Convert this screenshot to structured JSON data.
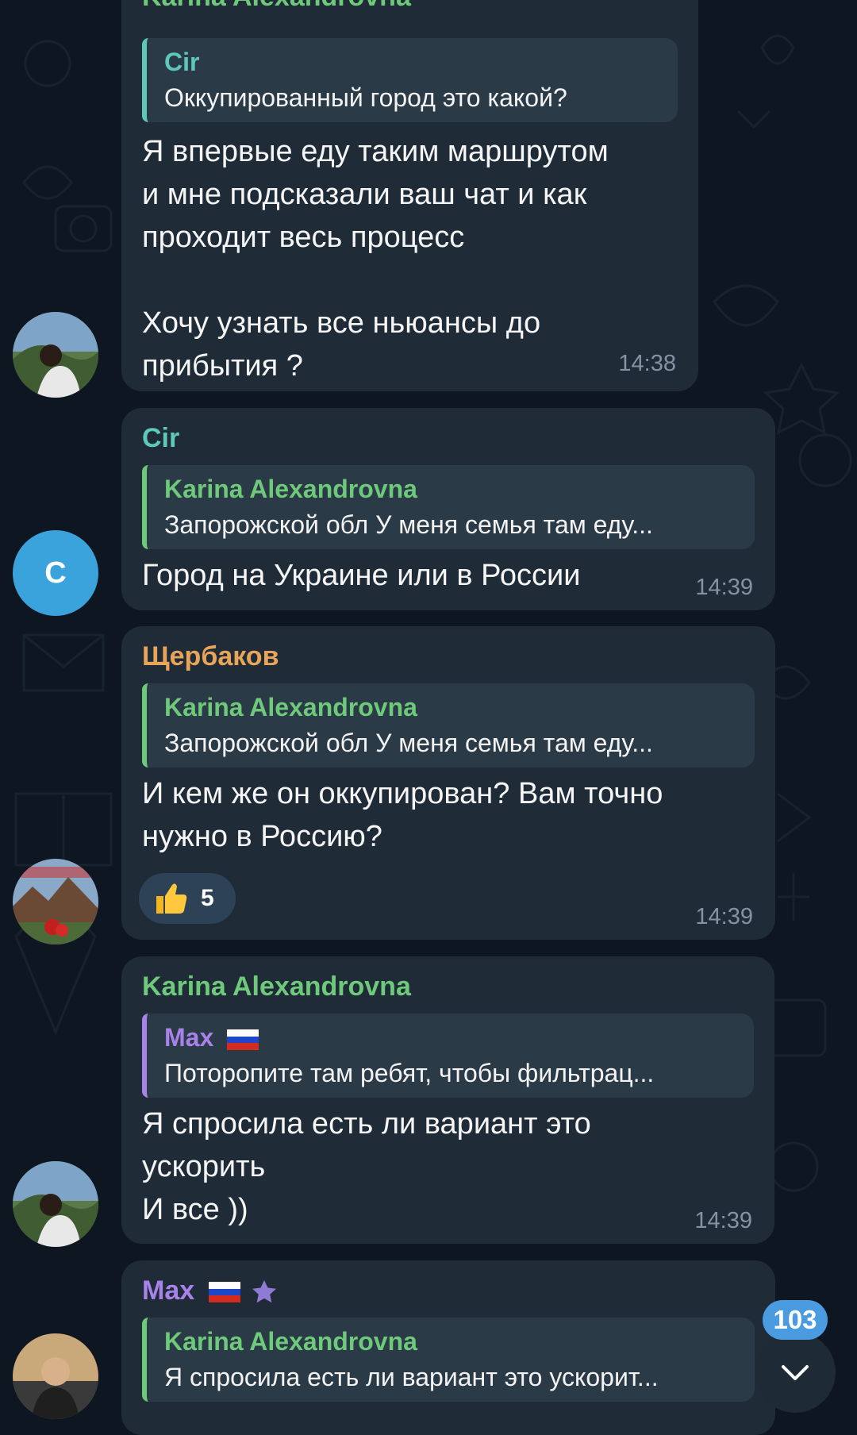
{
  "colors": {
    "background": "#0e1621",
    "bubble": "#1f2c38",
    "quote_bg": "#2b3a47",
    "green_name": "#6ec97a",
    "teal_name": "#5fc9b9",
    "orange_name": "#e8a459",
    "purple_name": "#a882e8",
    "time": "#8393a3",
    "badge": "#4a9be0"
  },
  "messages": [
    {
      "sender": "Karina Alexandrovna",
      "reply_to": {
        "name": "Cir",
        "text": "Оккупированный город это какой?"
      },
      "text": "Я впервые еду таким маршрутом\nи мне подсказали ваш чат и как\nпроходит весь процесс\n\nХочу узнать все ньюансы до\nприбытия ?",
      "time": "14:38",
      "avatar": "photo-avatar-karina"
    },
    {
      "sender": "Cir",
      "reply_to": {
        "name": "Karina Alexandrovna",
        "text": "Запорожской обл  У меня семья там еду..."
      },
      "text": "Город на Украине или в России",
      "time": "14:39",
      "avatar_letter": "C"
    },
    {
      "sender": "Щербаков",
      "reply_to": {
        "name": "Karina Alexandrovna",
        "text": "Запорожской обл  У меня семья там еду..."
      },
      "text": "И кем же он оккупирован? Вам точно\nнужно в Россию?",
      "time": "14:39",
      "reaction": {
        "emoji": "thumbs-up-icon",
        "count": "5"
      },
      "avatar": "photo-avatar-mountains"
    },
    {
      "sender": "Karina Alexandrovna",
      "reply_to": {
        "name": "Max",
        "text": "Поторопите там ребят, чтобы фильтрац..."
      },
      "text": "Я спросила есть ли вариант это\nускорить\nИ все ))",
      "time": "14:39",
      "avatar": "photo-avatar-karina"
    },
    {
      "sender": "Max",
      "reply_to": {
        "name": "Karina Alexandrovna",
        "text": "Я спросила есть ли вариант это ускорит..."
      },
      "avatar": "photo-avatar-max"
    }
  ],
  "unread_count": "103",
  "scroll_icon": "chevron-down-icon"
}
